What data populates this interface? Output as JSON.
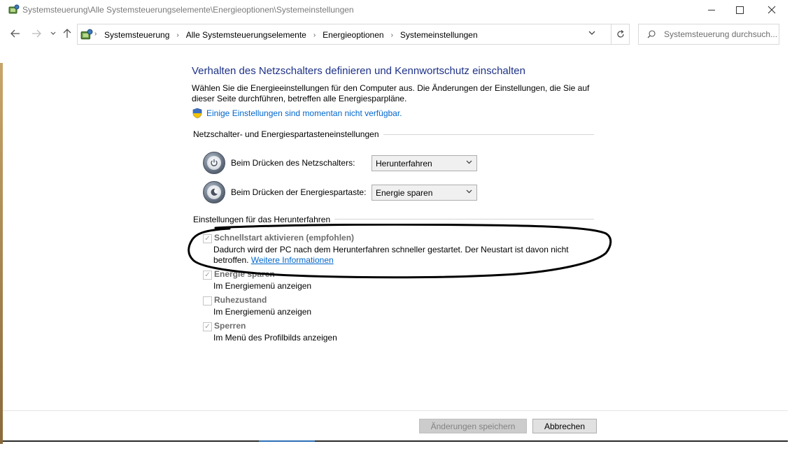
{
  "window": {
    "title": "Systemsteuerung\\Alle Systemsteuerungselemente\\Energieoptionen\\Systemeinstellungen"
  },
  "address": {
    "crumbs": [
      "Systemsteuerung",
      "Alle Systemsteuerungselemente",
      "Energieoptionen",
      "Systemeinstellungen"
    ],
    "search_placeholder": "Systemsteuerung durchsuch..."
  },
  "page": {
    "heading": "Verhalten des Netzschalters definieren und Kennwortschutz einschalten",
    "description": "Wählen Sie die Energieeinstellungen für den Computer aus. Die Änderungen der Einstellungen, die Sie auf dieser Seite durchführen, betreffen alle Energiesparpläne.",
    "unavailable_link": "Einige Einstellungen sind momentan nicht verfügbar.",
    "section_power": "Netzschalter- und Energiespartasteneinstellungen",
    "power_button_label": "Beim Drücken des Netzschalters:",
    "power_button_value": "Herunterfahren",
    "sleep_button_label": "Beim Drücken der Energiespartaste:",
    "sleep_button_value": "Energie sparen",
    "section_shutdown": "Einstellungen für das Herunterfahren",
    "fast_startup": {
      "title": "Schnellstart aktivieren (empfohlen)",
      "desc_line1": "Dadurch wird der PC nach dem Herunterfahren schneller gestartet. Der Neustart ist davon nicht",
      "desc_line2": "betroffen.",
      "more_link": "Weitere Informationen",
      "checked": true
    },
    "sleep": {
      "title": "Energie sparen",
      "desc": "Im Energiemenü anzeigen",
      "checked": true
    },
    "hibernate": {
      "title": "Ruhezustand",
      "desc": "Im Energiemenü anzeigen",
      "checked": false
    },
    "lock": {
      "title": "Sperren",
      "desc": "Im Menü des Profilbilds anzeigen",
      "checked": true
    }
  },
  "buttons": {
    "save": "Änderungen speichern",
    "cancel": "Abbrechen"
  },
  "colors": {
    "heading": "#1e3287",
    "link": "#0066cc",
    "disabled_text": "#6d6d6d"
  }
}
